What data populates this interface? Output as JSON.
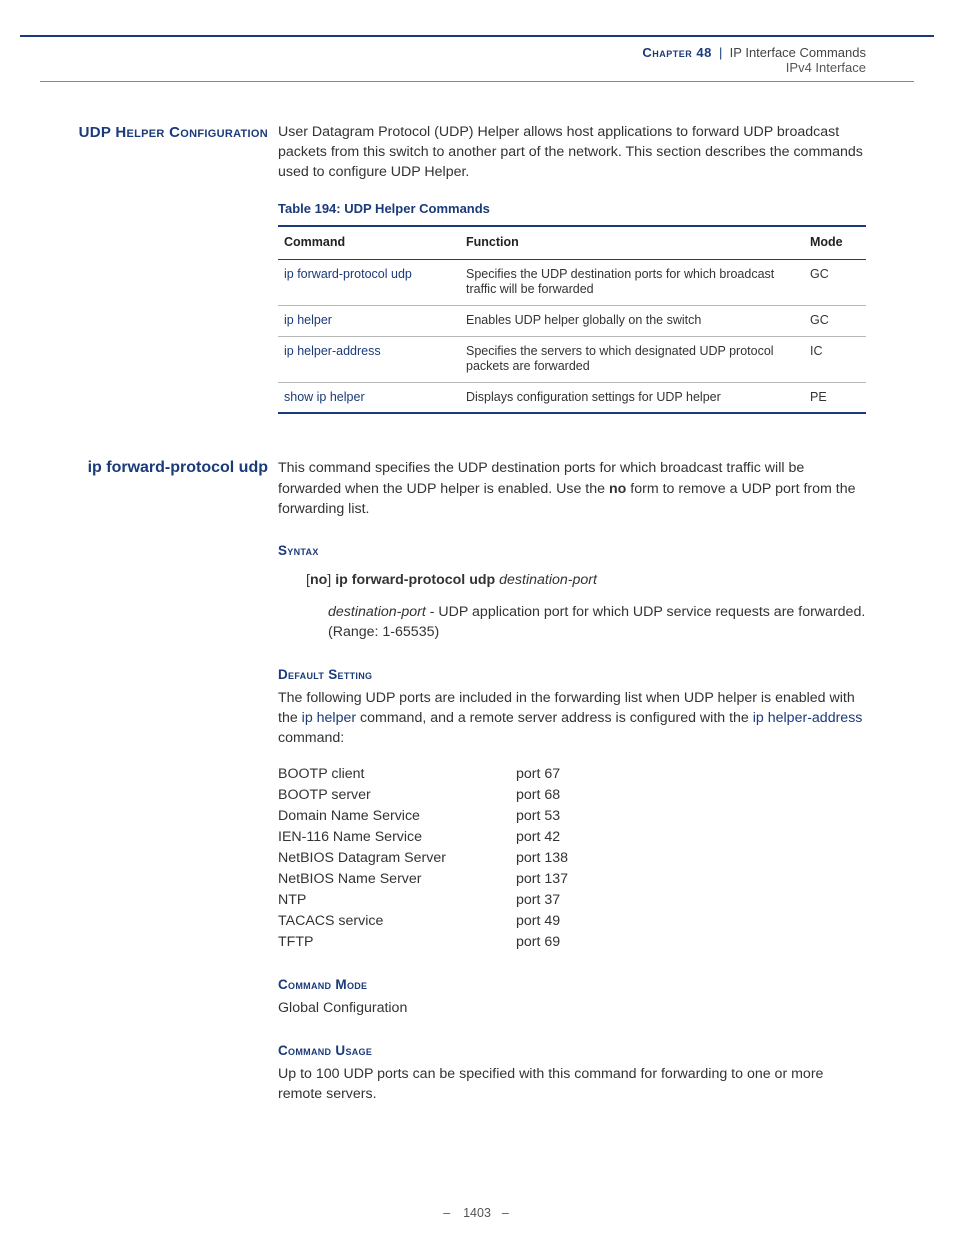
{
  "header": {
    "chapter": "Chapter 48",
    "sep": "|",
    "title": "IP Interface Commands",
    "subtitle": "IPv4 Interface"
  },
  "section1": {
    "side": "UDP Helper Configuration",
    "intro": "User Datagram Protocol (UDP) Helper allows host applications to forward UDP broadcast packets from this switch to another part of the network. This section describes the commands used to configure UDP Helper.",
    "table_caption": "Table 194: UDP Helper Commands",
    "table_head": {
      "c1": "Command",
      "c2": "Function",
      "c3": "Mode"
    },
    "rows": [
      {
        "cmd": "ip forward-protocol udp",
        "func": "Specifies the UDP destination ports for which broadcast traffic will be forwarded",
        "mode": "GC"
      },
      {
        "cmd": "ip helper",
        "func": "Enables UDP helper globally on the switch",
        "mode": "GC"
      },
      {
        "cmd": "ip helper-address",
        "func": "Specifies the servers to which designated UDP protocol packets are forwarded",
        "mode": "IC"
      },
      {
        "cmd": "show ip helper",
        "func": "Displays configuration settings for UDP helper",
        "mode": "PE"
      }
    ]
  },
  "section2": {
    "side": "ip forward-protocol udp",
    "desc_pre": "This command specifies the UDP destination ports for which broadcast traffic will be forwarded when the UDP helper is enabled. Use the ",
    "desc_bold": "no",
    "desc_post": " form to remove a UDP port from the forwarding list.",
    "syntax_head": "Syntax",
    "syntax": {
      "no": "no",
      "cmd": "ip forward-protocol udp",
      "arg": "destination-port"
    },
    "param_name": "destination-port",
    "param_desc": " - UDP application port for which UDP service requests are forwarded. (Range: 1-65535)",
    "default_head": "Default Setting",
    "default_pre": "The following UDP ports are included in the forwarding list when UDP helper is enabled with the ",
    "default_link1": "ip helper",
    "default_mid": " command, and a remote server address is configured with the ",
    "default_link2": "ip helper-address",
    "default_post": " command:",
    "ports": [
      {
        "name": "BOOTP client",
        "port": "port 67"
      },
      {
        "name": "BOOTP server",
        "port": "port 68"
      },
      {
        "name": "Domain Name Service",
        "port": "port 53"
      },
      {
        "name": "IEN-116 Name Service",
        "port": "port 42"
      },
      {
        "name": "NetBIOS Datagram Server",
        "port": "port 138"
      },
      {
        "name": "NetBIOS Name Server",
        "port": "port 137"
      },
      {
        "name": "NTP",
        "port": "port 37"
      },
      {
        "name": "TACACS service",
        "port": "port 49"
      },
      {
        "name": "TFTP",
        "port": "port 69"
      }
    ],
    "mode_head": "Command Mode",
    "mode_text": "Global Configuration",
    "usage_head": "Command Usage",
    "usage_text": "Up to 100 UDP ports can be specified with this command for forwarding to one or more remote servers."
  },
  "footer": {
    "page": "1403"
  }
}
